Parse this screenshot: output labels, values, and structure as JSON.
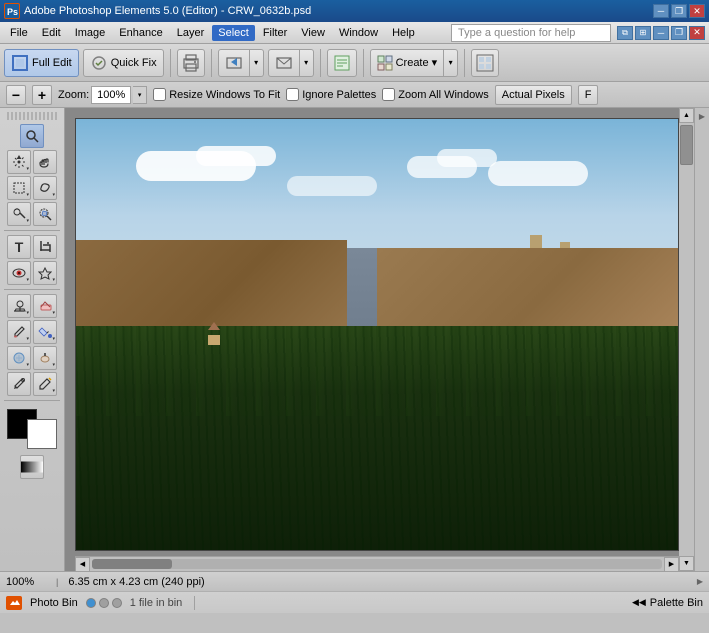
{
  "window": {
    "title": "Adobe Photoshop Elements 5.0 (Editor) - CRW_0632b.psd",
    "icon_label": "PS"
  },
  "menu": {
    "items": [
      "File",
      "Edit",
      "Image",
      "Enhance",
      "Layer",
      "Select",
      "Filter",
      "View",
      "Window",
      "Help"
    ],
    "help_placeholder": "Type a question for help"
  },
  "toolbar": {
    "full_edit_label": "Full Edit",
    "quick_fix_label": "Quick Fix",
    "print_label": "Print",
    "create_label": "Create ▾"
  },
  "options_bar": {
    "zoom_label": "Zoom:",
    "zoom_value": "100%",
    "resize_windows_label": "Resize Windows To Fit",
    "ignore_palettes_label": "Ignore Palettes",
    "zoom_all_windows_label": "Zoom All Windows",
    "actual_pixels_label": "Actual Pixels",
    "fit_label": "F"
  },
  "status_bar": {
    "zoom": "100%",
    "dimensions": "6.35 cm x 4.23 cm (240 ppi)"
  },
  "bottom_bar": {
    "photo_bin_label": "Photo Bin",
    "files_label": "1 file in bin",
    "palette_bin_label": "Palette Bin"
  },
  "tools": [
    {
      "name": "zoom-tool",
      "icon": "🔍"
    },
    {
      "name": "move-tool",
      "icon": "✥"
    },
    {
      "name": "lasso-tool",
      "icon": "🪢"
    },
    {
      "name": "magic-wand-tool",
      "icon": "✦"
    },
    {
      "name": "type-tool",
      "icon": "T"
    },
    {
      "name": "crop-tool",
      "icon": "⌗"
    },
    {
      "name": "red-eye-tool",
      "icon": "👁"
    },
    {
      "name": "stamp-tool",
      "icon": "◉"
    },
    {
      "name": "eraser-tool",
      "icon": "◻"
    },
    {
      "name": "brush-tool",
      "icon": "✏"
    },
    {
      "name": "blur-tool",
      "icon": "◌"
    },
    {
      "name": "sponge-tool",
      "icon": "◈"
    },
    {
      "name": "hand-tool",
      "icon": "☞"
    },
    {
      "name": "eyedropper-tool",
      "icon": "🖊"
    },
    {
      "name": "paint-bucket-tool",
      "icon": "🪣"
    },
    {
      "name": "healing-brush-tool",
      "icon": "✚"
    },
    {
      "name": "smudge-tool",
      "icon": "〜"
    },
    {
      "name": "dodge-tool",
      "icon": "○"
    },
    {
      "name": "gradient-tool",
      "icon": "▦"
    },
    {
      "name": "selection-tool",
      "icon": "⬚"
    }
  ]
}
